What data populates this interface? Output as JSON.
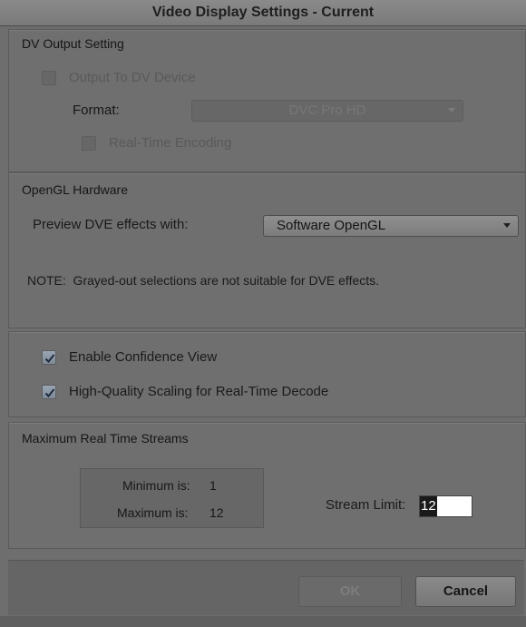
{
  "window": {
    "title": "Video Display Settings - Current"
  },
  "dv_output": {
    "title": "DV Output Setting",
    "output_to_dv_label": "Output To DV Device",
    "output_to_dv_checked": false,
    "format_label": "Format:",
    "format_value": "DVC Pro HD",
    "realtime_encoding_label": "Real-Time Encoding",
    "realtime_encoding_checked": false
  },
  "opengl": {
    "title": "OpenGL Hardware",
    "preview_label": "Preview DVE effects with:",
    "preview_value": "Software OpenGL",
    "note": "NOTE:  Grayed-out selections are not suitable for DVE effects."
  },
  "options": {
    "confidence_label": "Enable Confidence View",
    "confidence_checked": true,
    "scaling_label": "High-Quality Scaling for Real-Time Decode",
    "scaling_checked": true
  },
  "streams": {
    "title": "Maximum Real Time Streams",
    "minimum_label": "Minimum is:",
    "minimum_value": "1",
    "maximum_label": "Maximum is:",
    "maximum_value": "12",
    "limit_label": "Stream Limit:",
    "limit_value": "12"
  },
  "buttons": {
    "ok": "OK",
    "cancel": "Cancel"
  },
  "icons": {
    "checkbox_check": "checkmark-icon",
    "dropdown": "chevron-down-icon"
  }
}
